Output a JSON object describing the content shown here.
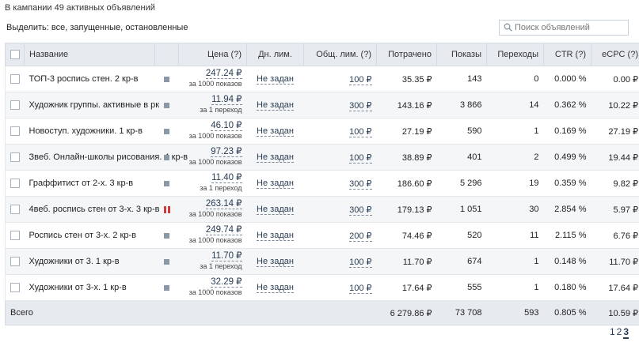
{
  "campaign_summary": "В кампании 49 активных объявлений",
  "filter": {
    "label": "Выделить:",
    "all": "все,",
    "running": "запущенные,",
    "stopped": "остановленные"
  },
  "search": {
    "placeholder": "Поиск объявлений",
    "icon": "search-icon"
  },
  "table": {
    "headers": {
      "name": "Название",
      "price": "Цена (?)",
      "day_limit": "Дн. лим.",
      "total_limit": "Общ. лим. (?)",
      "spent": "Потрачено",
      "impressions": "Показы",
      "clicks": "Переходы",
      "ctr": "CTR (?)",
      "ecpc": "eCPC (?)"
    },
    "rows": [
      {
        "name": "ТОП-3 роспись стен. 2 кр-в",
        "status": "active",
        "price": "247.24 ₽",
        "price_unit": "за 1000 показов",
        "day_limit": "Не задан",
        "total_limit": "100 ₽",
        "spent": "35.35 ₽",
        "impressions": "143",
        "clicks": "0",
        "ctr": "0.000 %",
        "ecpc": "0.00 ₽"
      },
      {
        "name": "Художник группы. активные в рк",
        "status": "active",
        "price": "11.94 ₽",
        "price_unit": "за 1 переход",
        "day_limit": "Не задан",
        "total_limit": "300 ₽",
        "spent": "143.16 ₽",
        "impressions": "3 866",
        "clicks": "14",
        "ctr": "0.362 %",
        "ecpc": "10.22 ₽"
      },
      {
        "name": "Новоступ. художники. 1 кр-в",
        "status": "active",
        "price": "46.10 ₽",
        "price_unit": "за 1000 показов",
        "day_limit": "Не задан",
        "total_limit": "100 ₽",
        "spent": "27.19 ₽",
        "impressions": "590",
        "clicks": "1",
        "ctr": "0.169 %",
        "ecpc": "27.19 ₽"
      },
      {
        "name": "Звеб. Онлайн-школы рисования. 4 кр-в",
        "status": "active",
        "price": "97.23 ₽",
        "price_unit": "за 1000 показов",
        "day_limit": "Не задан",
        "total_limit": "100 ₽",
        "spent": "38.89 ₽",
        "impressions": "401",
        "clicks": "2",
        "ctr": "0.499 %",
        "ecpc": "19.44 ₽"
      },
      {
        "name": "Граффитист от 2-х. 3 кр-в",
        "status": "active",
        "price": "11.40 ₽",
        "price_unit": "за 1 переход",
        "day_limit": "Не задан",
        "total_limit": "300 ₽",
        "spent": "186.60 ₽",
        "impressions": "5 296",
        "clicks": "19",
        "ctr": "0.359 %",
        "ecpc": "9.82 ₽"
      },
      {
        "name": "4веб. роспись стен от 3-х. 3 кр-в",
        "status": "paused",
        "price": "263.14 ₽",
        "price_unit": "за 1000 показов",
        "day_limit": "Не задан",
        "total_limit": "300 ₽",
        "spent": "179.13 ₽",
        "impressions": "1 051",
        "clicks": "30",
        "ctr": "2.854 %",
        "ecpc": "5.97 ₽"
      },
      {
        "name": "Роспись стен от 3-х. 2 кр-в",
        "status": "active",
        "price": "249.74 ₽",
        "price_unit": "за 1000 показов",
        "day_limit": "Не задан",
        "total_limit": "200 ₽",
        "spent": "74.46 ₽",
        "impressions": "520",
        "clicks": "11",
        "ctr": "2.115 %",
        "ecpc": "6.76 ₽"
      },
      {
        "name": "Художники от 3. 1 кр-в",
        "status": "active",
        "price": "11.70 ₽",
        "price_unit": "за 1 переход",
        "day_limit": "Не задан",
        "total_limit": "100 ₽",
        "spent": "11.70 ₽",
        "impressions": "674",
        "clicks": "1",
        "ctr": "0.148 %",
        "ecpc": "11.70 ₽"
      },
      {
        "name": "Художники от 3-х. 1 кр-в",
        "status": "active",
        "price": "32.29 ₽",
        "price_unit": "за 1000 показов",
        "day_limit": "Не задан",
        "total_limit": "100 ₽",
        "spent": "17.64 ₽",
        "impressions": "555",
        "clicks": "1",
        "ctr": "0.180 %",
        "ecpc": "17.64 ₽"
      }
    ],
    "total": {
      "label": "Всего",
      "spent": "6 279.86 ₽",
      "impressions": "73 708",
      "clicks": "593",
      "ctr": "0.805 %",
      "ecpc": "10.59 ₽"
    }
  },
  "pagination": {
    "pages": [
      "1",
      "2",
      "3"
    ],
    "current": "3"
  },
  "colors": {
    "accent": "#2a3c52",
    "paused": "#d03a3a",
    "header_bg": "#e7ebf0"
  }
}
